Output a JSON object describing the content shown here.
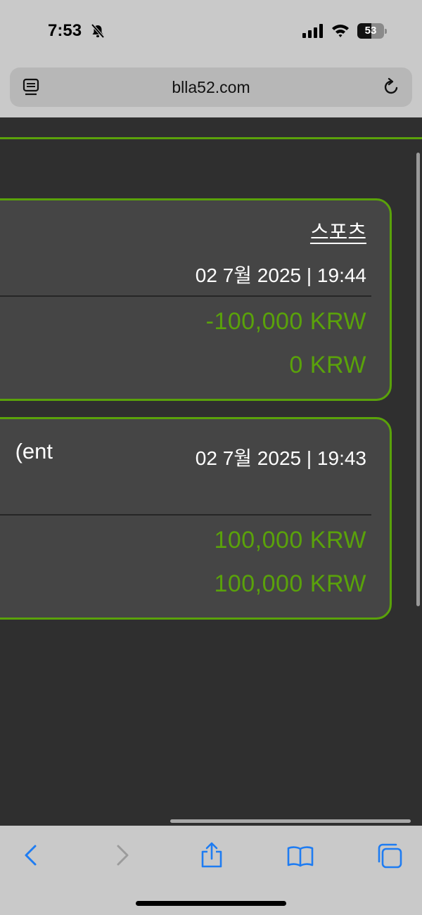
{
  "status_bar": {
    "time": "7:53",
    "battery": "53",
    "battery_level": 0.53
  },
  "browser": {
    "url": "blla52.com"
  },
  "cards": [
    {
      "category": "스포츠",
      "date": "02 7월 2025 | 19:44",
      "amount_1": "-100,000 KRW",
      "amount_2": "0 KRW"
    },
    {
      "left_text": "ent)",
      "date": "02 7월 2025 | 19:43",
      "amount_1": "100,000 KRW",
      "amount_2": "100,000 KRW"
    }
  ],
  "colors": {
    "accent_green": "#5aa20a",
    "page_background": "#2f2f2f",
    "card_background": "#454545",
    "toolbar_blue": "#1e7cf2"
  },
  "icons": {
    "status": [
      "bell-muted-icon",
      "cellular-signal-icon",
      "wifi-icon",
      "battery-icon"
    ],
    "url_bar": [
      "tab-list-icon",
      "reload-icon"
    ],
    "toolbar": [
      "back-icon",
      "forward-icon",
      "share-icon",
      "bookmarks-icon",
      "tabs-overview-icon"
    ]
  }
}
